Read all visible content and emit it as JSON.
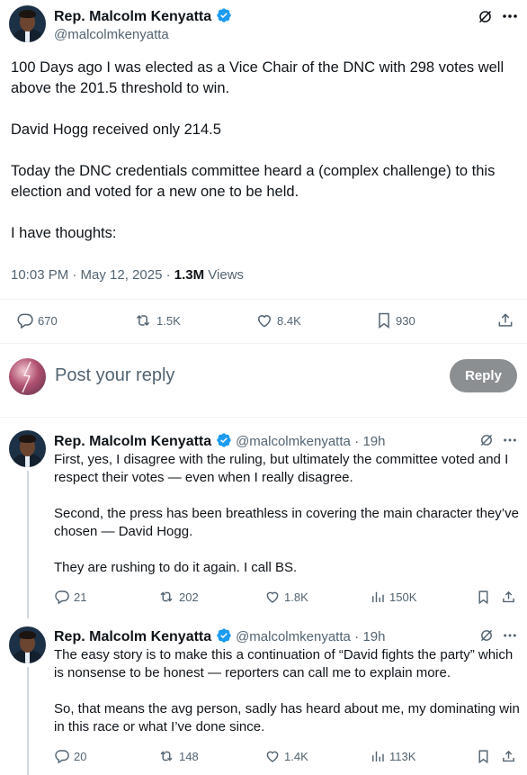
{
  "main_post": {
    "author_name": "Rep. Malcolm Kenyatta",
    "author_handle": "@malcolmkenyatta",
    "text": "100 Days ago I was elected as a Vice Chair of the DNC with 298 votes well above the 201.5 threshold to win.\n\nDavid Hogg received only 214.5\n\nToday the DNC credentials committee heard a (complex challenge) to this election and voted for a new one to be held.\n\nI have thoughts:",
    "timestamp": "10:03 PM · May 12, 2025 · ",
    "views_count": "1.3M",
    "views_label": " Views",
    "stats": {
      "replies": "670",
      "reposts": "1.5K",
      "likes": "8.4K",
      "bookmarks": "930"
    }
  },
  "composer": {
    "placeholder": "Post your reply",
    "button_label": "Reply"
  },
  "replies": [
    {
      "author_name": "Rep. Malcolm Kenyatta",
      "author_handle": "@malcolmkenyatta",
      "time": "· 19h",
      "text": "First, yes, I disagree with the ruling, but ultimately the committee voted and I respect their votes — even when I really disagree.\n\nSecond, the press has been breathless in covering the main character they’ve chosen — David Hogg.\n\nThey are rushing to do it again. I call BS.",
      "stats": {
        "replies": "21",
        "reposts": "202",
        "likes": "1.8K",
        "views": "150K"
      }
    },
    {
      "author_name": "Rep. Malcolm Kenyatta",
      "author_handle": "@malcolmkenyatta",
      "time": "· 19h",
      "text": "The easy story is to make this a continuation of “David fights the party” which is nonsense to be honest — reporters can call me to explain more.\n\nSo, that means the avg person, sadly has heard about me, my dominating win in this race or what I’ve done since.",
      "stats": {
        "replies": "20",
        "reposts": "148",
        "likes": "1.4K",
        "views": "113K"
      }
    }
  ],
  "colors": {
    "verified": "#1d9bf0",
    "secondary_text": "#536471",
    "primary_text": "#0f1419",
    "reply_button": "#8c8f92"
  },
  "icons": [
    "verified-badge-icon",
    "grok-icon",
    "more-icon",
    "reply-icon",
    "repost-icon",
    "like-icon",
    "bookmark-icon",
    "share-icon",
    "views-icon"
  ]
}
